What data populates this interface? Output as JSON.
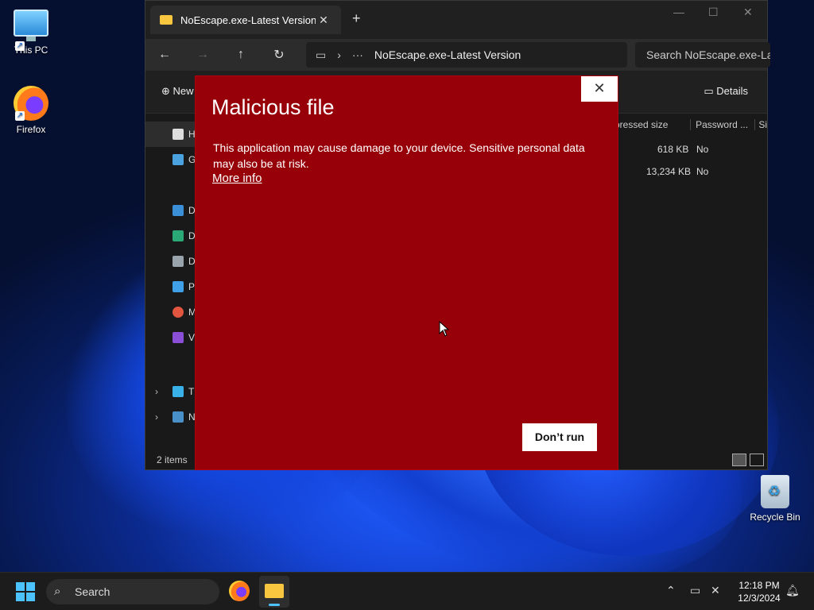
{
  "desktop": {
    "icons": [
      {
        "label": "This PC",
        "icon": "computer-icon"
      },
      {
        "label": "Firefox",
        "icon": "firefox-icon"
      },
      {
        "label": "Recycle Bin",
        "icon": "recycle-bin-icon"
      }
    ]
  },
  "explorer": {
    "tab_title": "NoEscape.exe-Latest Version",
    "address_path": "NoEscape.exe-Latest Version",
    "search_placeholder": "Search NoEscape.exe-Lat",
    "toolbar": {
      "new_label": "New",
      "details_label": "Details"
    },
    "sidebar": [
      {
        "label": "H",
        "icon": "home-icon"
      },
      {
        "label": "G",
        "icon": "gallery-icon"
      },
      {
        "label": "D",
        "icon": "desktop-icon"
      },
      {
        "label": "D",
        "icon": "downloads-icon"
      },
      {
        "label": "D",
        "icon": "documents-icon"
      },
      {
        "label": "Pi",
        "icon": "pictures-icon"
      },
      {
        "label": "M",
        "icon": "music-icon"
      },
      {
        "label": "Vi",
        "icon": "videos-icon"
      },
      {
        "label": "Th",
        "icon": "this-pc-icon"
      },
      {
        "label": "N",
        "icon": "network-icon"
      }
    ],
    "columns": [
      "pressed size",
      "Password ...",
      "Si"
    ],
    "rows": [
      {
        "compressed_size": "618 KB",
        "password": "No"
      },
      {
        "compressed_size": "13,234 KB",
        "password": "No"
      }
    ],
    "status": "2 items"
  },
  "dialog": {
    "title": "Malicious file",
    "body": "This application may cause damage to your device. Sensitive personal data may also be at risk.",
    "link": "More info",
    "button": "Don’t run",
    "close": "✕",
    "bg_color": "#970008"
  },
  "taskbar": {
    "search_label": "Search",
    "time": "12:18 PM",
    "date": "12/3/2024"
  }
}
